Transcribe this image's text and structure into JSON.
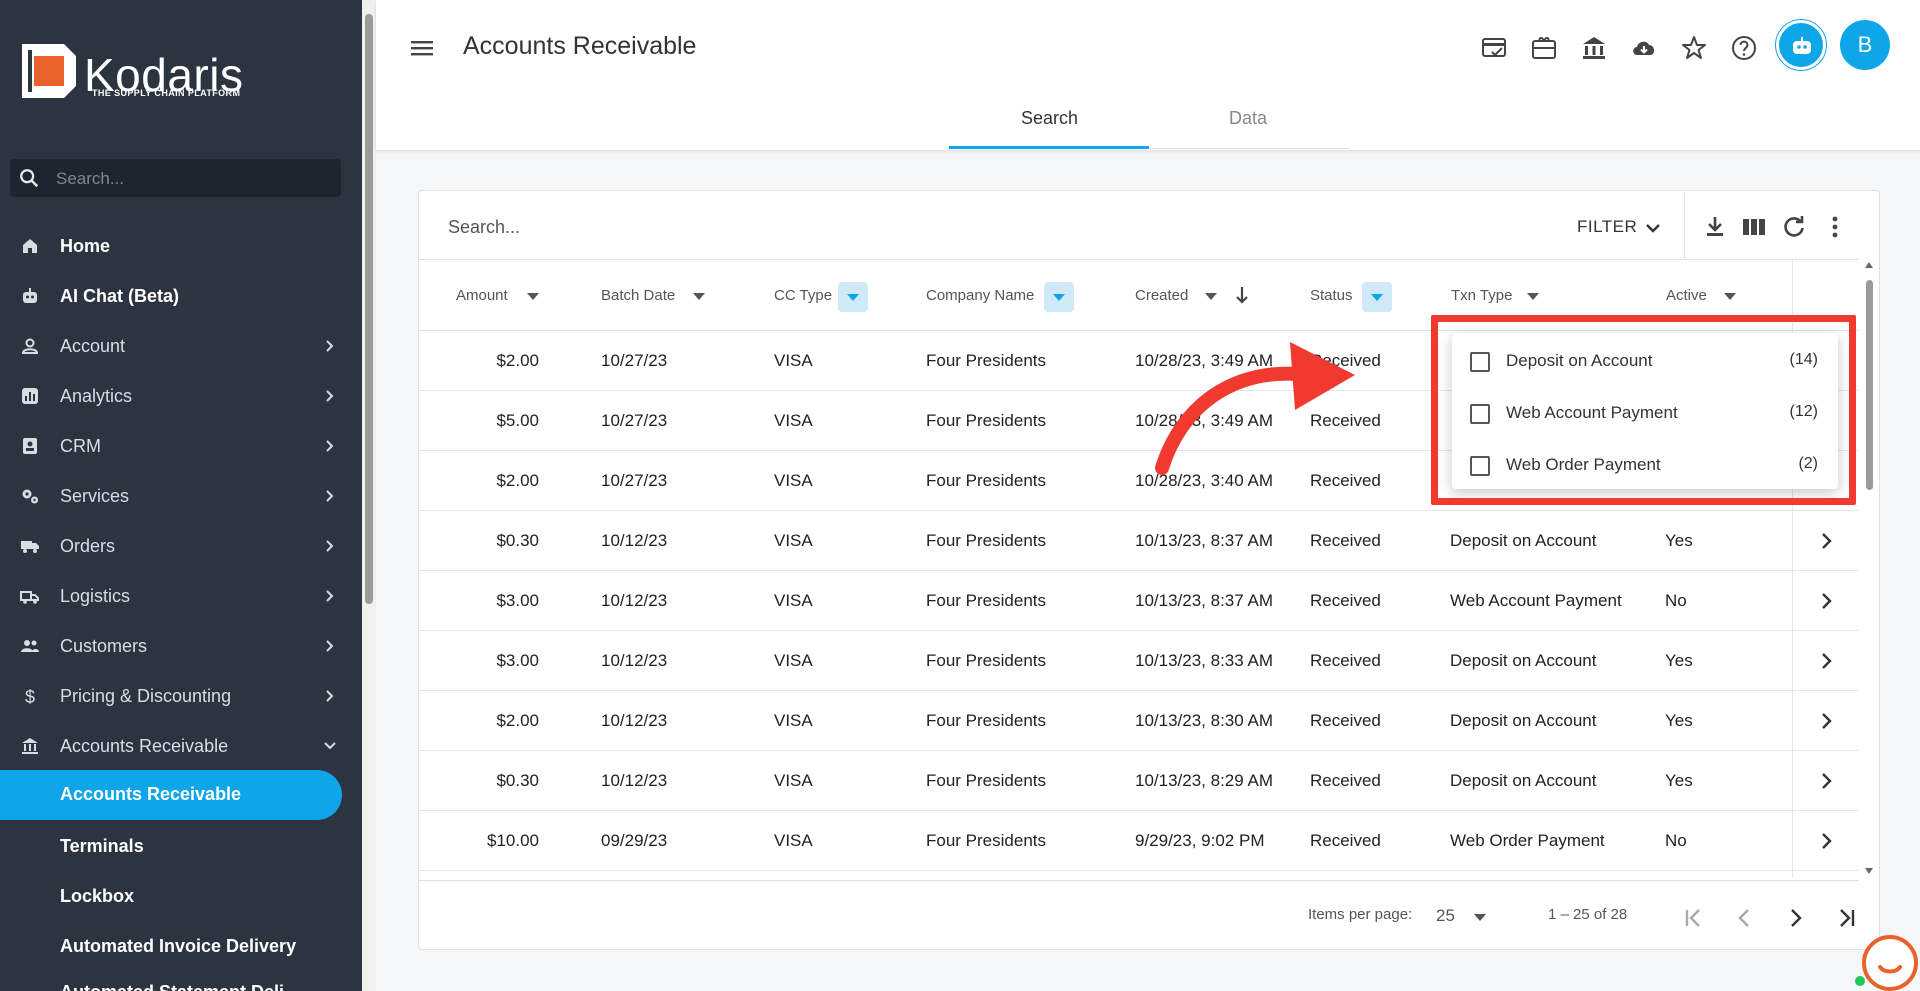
{
  "brand": {
    "name": "Kodaris",
    "tagline": "THE SUPPLY CHAIN PLATFORM"
  },
  "sidebar": {
    "search_placeholder": "Search...",
    "items": [
      {
        "label": "Home",
        "icon": "home-icon",
        "bold": true,
        "has_chevron": false
      },
      {
        "label": "AI Chat (Beta)",
        "icon": "robot-icon",
        "bold": true,
        "has_chevron": false
      },
      {
        "label": "Account",
        "icon": "person-icon",
        "bold": false,
        "has_chevron": true
      },
      {
        "label": "Analytics",
        "icon": "analytics-icon",
        "bold": false,
        "has_chevron": true
      },
      {
        "label": "CRM",
        "icon": "contact-card-icon",
        "bold": false,
        "has_chevron": true
      },
      {
        "label": "Services",
        "icon": "gears-icon",
        "bold": false,
        "has_chevron": true
      },
      {
        "label": "Orders",
        "icon": "truck-icon",
        "bold": false,
        "has_chevron": true
      },
      {
        "label": "Logistics",
        "icon": "shipping-icon",
        "bold": false,
        "has_chevron": true
      },
      {
        "label": "Customers",
        "icon": "people-icon",
        "bold": false,
        "has_chevron": true
      },
      {
        "label": "Pricing & Discounting",
        "icon": "dollar-icon",
        "bold": false,
        "has_chevron": true
      },
      {
        "label": "Accounts Receivable",
        "icon": "bank-icon",
        "bold": false,
        "has_chevron": true,
        "expanded": true
      }
    ],
    "sub_items": [
      {
        "label": "Accounts Receivable",
        "active": true
      },
      {
        "label": "Terminals"
      },
      {
        "label": "Lockbox"
      },
      {
        "label": "Automated Invoice Delivery"
      },
      {
        "label": "Automated Statement Deli..."
      }
    ]
  },
  "header": {
    "title": "Accounts Receivable",
    "tabs": [
      {
        "label": "Search",
        "active": true
      },
      {
        "label": "Data",
        "active": false
      }
    ],
    "icons": [
      "card-check-icon",
      "gift-card-icon",
      "bank-icon",
      "cloud-download-icon",
      "star-icon",
      "help-icon"
    ],
    "avatar_initial": "B"
  },
  "table": {
    "search_placeholder": "Search...",
    "filter_label": "FILTER",
    "columns": [
      "Amount",
      "Batch Date",
      "CC Type",
      "Company Name",
      "Created",
      "Status",
      "Txn Type",
      "Active"
    ],
    "rows": [
      {
        "amount": "$2.00",
        "batch_date": "10/27/23",
        "cc_type": "VISA",
        "company": "Four Presidents",
        "created": "10/28/23, 3:49 AM",
        "status": "Received",
        "txn_type": "",
        "active": ""
      },
      {
        "amount": "$5.00",
        "batch_date": "10/27/23",
        "cc_type": "VISA",
        "company": "Four Presidents",
        "created": "10/28/23, 3:49 AM",
        "status": "Received",
        "txn_type": "",
        "active": ""
      },
      {
        "amount": "$2.00",
        "batch_date": "10/27/23",
        "cc_type": "VISA",
        "company": "Four Presidents",
        "created": "10/28/23, 3:40 AM",
        "status": "Received",
        "txn_type": "",
        "active": ""
      },
      {
        "amount": "$0.30",
        "batch_date": "10/12/23",
        "cc_type": "VISA",
        "company": "Four Presidents",
        "created": "10/13/23, 8:37 AM",
        "status": "Received",
        "txn_type": "Deposit on Account",
        "active": "Yes"
      },
      {
        "amount": "$3.00",
        "batch_date": "10/12/23",
        "cc_type": "VISA",
        "company": "Four Presidents",
        "created": "10/13/23, 8:37 AM",
        "status": "Received",
        "txn_type": "Web Account Payment",
        "active": "No"
      },
      {
        "amount": "$3.00",
        "batch_date": "10/12/23",
        "cc_type": "VISA",
        "company": "Four Presidents",
        "created": "10/13/23, 8:33 AM",
        "status": "Received",
        "txn_type": "Deposit on Account",
        "active": "Yes"
      },
      {
        "amount": "$2.00",
        "batch_date": "10/12/23",
        "cc_type": "VISA",
        "company": "Four Presidents",
        "created": "10/13/23, 8:30 AM",
        "status": "Received",
        "txn_type": "Deposit on Account",
        "active": "Yes"
      },
      {
        "amount": "$0.30",
        "batch_date": "10/12/23",
        "cc_type": "VISA",
        "company": "Four Presidents",
        "created": "10/13/23, 8:29 AM",
        "status": "Received",
        "txn_type": "Deposit on Account",
        "active": "Yes"
      },
      {
        "amount": "$10.00",
        "batch_date": "09/29/23",
        "cc_type": "VISA",
        "company": "Four Presidents",
        "created": "9/29/23, 9:02 PM",
        "status": "Received",
        "txn_type": "Web Order Payment",
        "active": "No"
      }
    ],
    "pager": {
      "items_per_page_label": "Items per page:",
      "page_size": "25",
      "range": "1 – 25 of 28"
    }
  },
  "txn_filter_dropdown": {
    "options": [
      {
        "label": "Deposit on Account",
        "count": "(14)",
        "checked": false
      },
      {
        "label": "Web Account Payment",
        "count": "(12)",
        "checked": false
      },
      {
        "label": "Web Order Payment",
        "count": "(2)",
        "checked": false
      }
    ]
  },
  "colors": {
    "accent": "#0ea5e9",
    "sidebar_bg": "#2b3440",
    "annotation": "#f03a30"
  }
}
